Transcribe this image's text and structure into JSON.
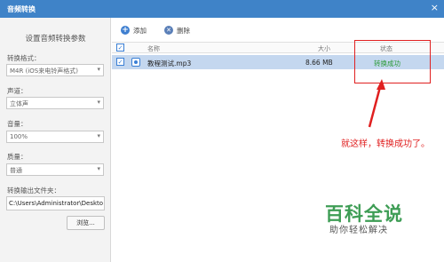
{
  "window": {
    "title": "音频转换",
    "close_glyph": "×"
  },
  "left_panel": {
    "title": "设置音频转换参数",
    "format": {
      "label": "转换格式：",
      "value": "M4R (iOS来电铃声格式)"
    },
    "channel": {
      "label": "声道：",
      "value": "立体声"
    },
    "volume": {
      "label": "音量：",
      "value": "100%"
    },
    "quality": {
      "label": "质量：",
      "value": "普通"
    },
    "output": {
      "label": "转换输出文件夹：",
      "value": "C:\\Users\\Administrator\\Deskto"
    },
    "browse_label": "浏览..."
  },
  "toolbar": {
    "add_label": "添加",
    "delete_label": "删除"
  },
  "table": {
    "headers": {
      "name": "名称",
      "size": "大小",
      "status": "状态"
    },
    "rows": [
      {
        "checked": true,
        "name": "教程测试.mp3",
        "size": "8.66 MB",
        "status": "转换成功"
      }
    ]
  },
  "annotation": {
    "text": "就这样，转换成功了。",
    "color": "#e02020"
  },
  "watermark": {
    "main": "百科全说",
    "sub": "助你轻松解决",
    "color": "#3e9d55"
  },
  "colors": {
    "accent": "#3f83c8",
    "row_selected": "#c4d7ef",
    "success": "#2a9a36"
  }
}
